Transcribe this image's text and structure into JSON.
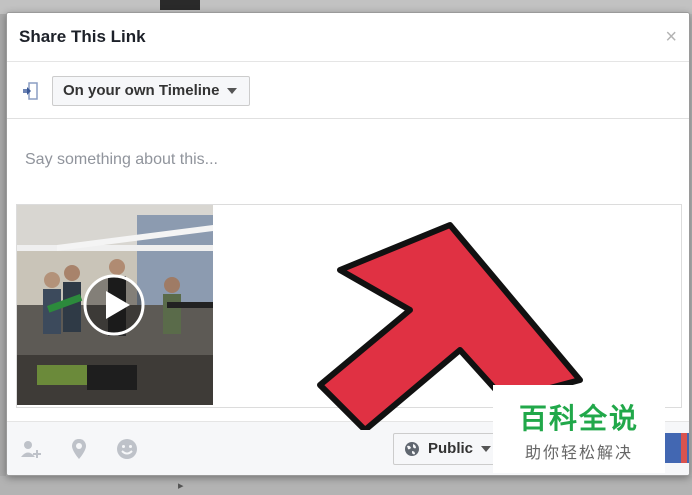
{
  "dialog": {
    "title": "Share This Link",
    "close_glyph": "×"
  },
  "target": {
    "icon": "share-target-icon",
    "dropdown_label": "On your own Timeline"
  },
  "composer": {
    "placeholder": "Say something about this..."
  },
  "attachment": {
    "thumbnail": "video-thumbnail-band",
    "play_icon": "play-icon"
  },
  "footer": {
    "tag_icon": "tag-friends-icon",
    "location_icon": "location-pin-icon",
    "feeling_icon": "feeling-smiley-icon",
    "privacy_label": "Public",
    "privacy_icon": "globe-icon"
  },
  "overlay": {
    "arrow_color": "#e03143",
    "watermark_main": "百科全说",
    "watermark_sub": "助你轻松解决"
  },
  "colors": {
    "primary": "#4267b2",
    "watermark_green": "#21a84a"
  }
}
